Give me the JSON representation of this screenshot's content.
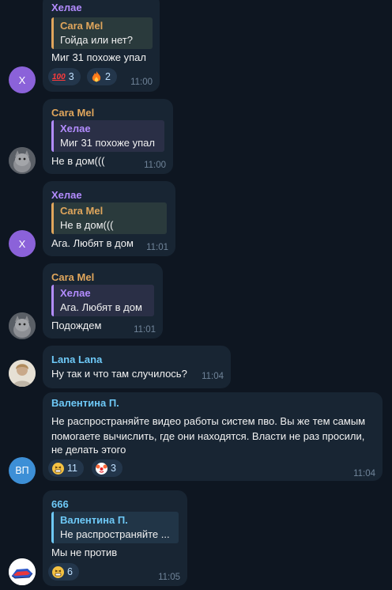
{
  "messages": [
    {
      "sender": "Хелае",
      "sender_color": "#b38cff",
      "quote": {
        "name": "Cara Mel",
        "text": "Гойда или нет?",
        "color": "#e0a65c"
      },
      "text_lines": [
        "Миг 31 похоже упал"
      ],
      "time": "11:00",
      "reactions": [
        {
          "icon": "hundred-emoji",
          "count": "3"
        },
        {
          "icon": "fire-emoji",
          "count": "2"
        }
      ],
      "avatar": {
        "initials": "Х",
        "color": "#8b62d9"
      }
    },
    {
      "sender": "Cara Mel",
      "sender_color": "#e0a65c",
      "quote": {
        "name": "Хелае",
        "text": "Миг 31 похоже упал",
        "color": "#b38cff"
      },
      "text_lines": [
        "Не в дом((("
      ],
      "time": "11:00",
      "avatar": {
        "type": "cat-photo"
      }
    },
    {
      "sender": "Хелае",
      "sender_color": "#b38cff",
      "quote": {
        "name": "Cara Mel",
        "text": "Не в дом(((",
        "color": "#e0a65c"
      },
      "text_lines": [
        "Ага. Любят в дом"
      ],
      "time": "11:01",
      "avatar": {
        "initials": "Х",
        "color": "#8b62d9"
      }
    },
    {
      "sender": "Cara Mel",
      "sender_color": "#e0a65c",
      "quote": {
        "name": "Хелае",
        "text": "Ага. Любят в дом",
        "color": "#b38cff"
      },
      "text_lines": [
        "Подождем"
      ],
      "time": "11:01",
      "avatar": {
        "type": "cat-photo"
      }
    },
    {
      "sender": "Lana Lana",
      "sender_color": "#6ec9f7",
      "text_lines": [
        "Ну так и что там случилось?"
      ],
      "time": "11:04",
      "avatar": {
        "type": "person-photo"
      }
    },
    {
      "sender": "Валентина П.",
      "sender_color": "#6ec9f7",
      "text_lines": [
        "Не распространяйте видео работы систем пво. Вы же тем самым",
        "помогаете вычислить, где они находятся. Власти не раз просили,",
        "не делать этого"
      ],
      "time": "11:04",
      "reactions": [
        {
          "icon": "grin-emoji",
          "count": "11"
        },
        {
          "icon": "clown-emoji",
          "count": "3"
        }
      ],
      "avatar": {
        "initials": "ВП",
        "color": "#3d8fd6"
      }
    },
    {
      "sender": "666",
      "sender_color": "#6ec9f7",
      "quote": {
        "name": "Валентина П.",
        "text": "Не распространяйте ...",
        "color": "#6ec9f7"
      },
      "text_lines": [
        "Мы не против"
      ],
      "time": "11:05",
      "reactions": [
        {
          "icon": "grin-emoji",
          "count": "6"
        }
      ],
      "avatar": {
        "type": "flag-logo"
      }
    }
  ]
}
